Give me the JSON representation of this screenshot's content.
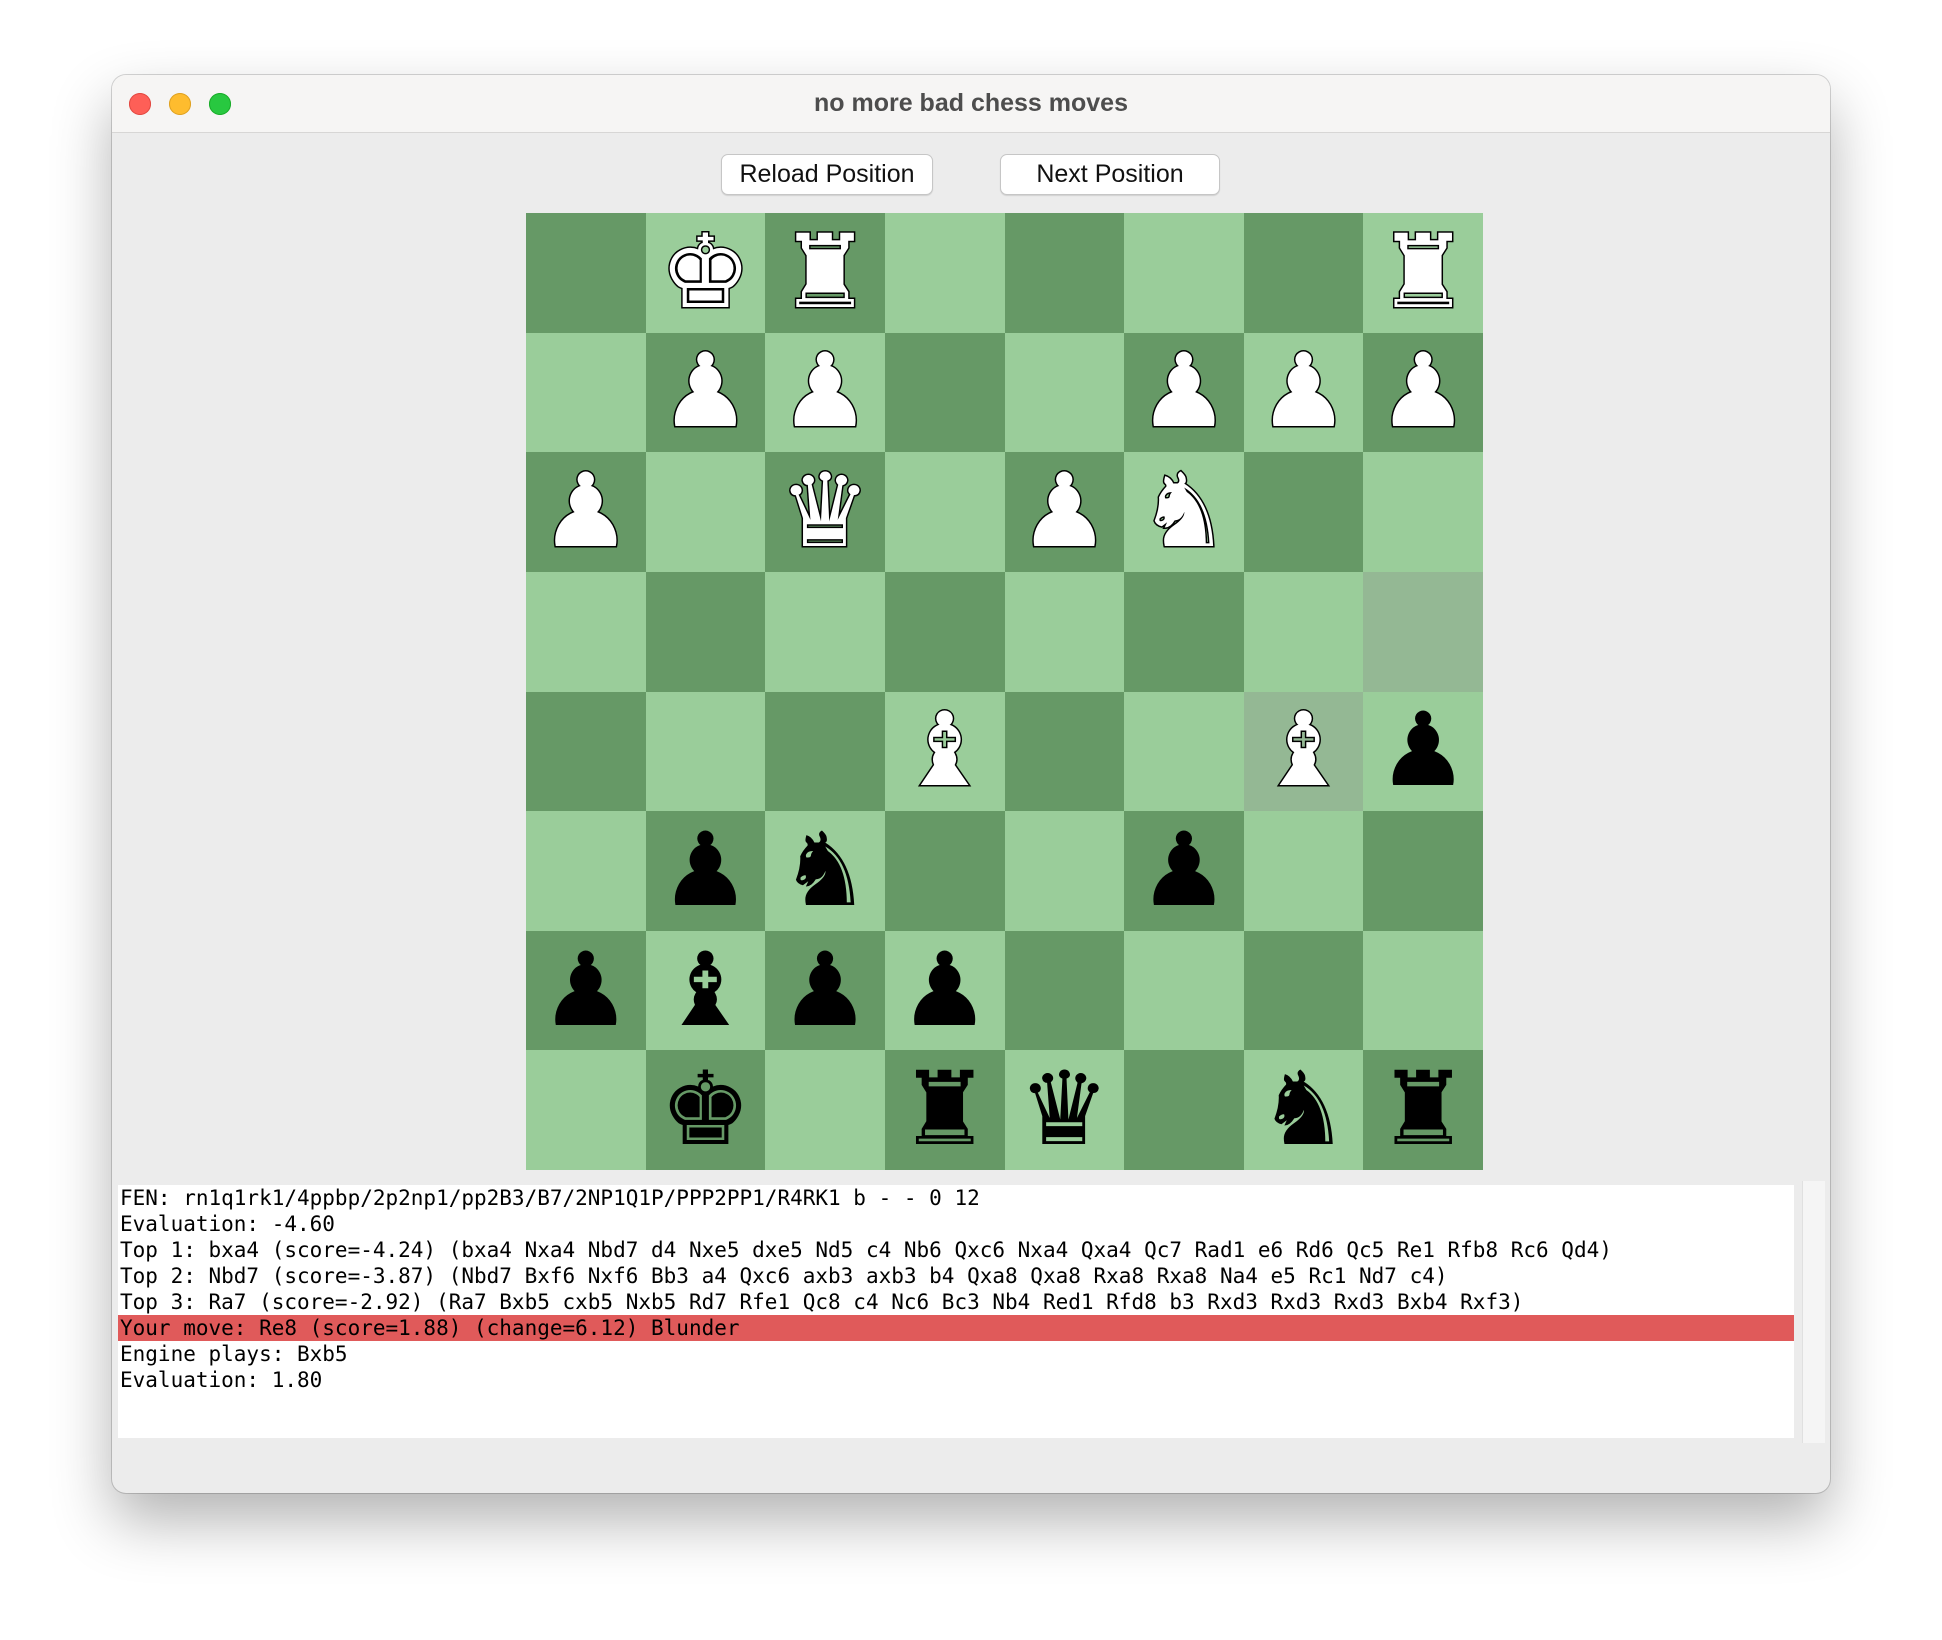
{
  "window": {
    "title": "no more bad chess moves"
  },
  "toolbar": {
    "reload_label": "Reload Position",
    "next_label": "Next Position"
  },
  "colors": {
    "light_square": "#9acd9a",
    "dark_square": "#669966",
    "highlight_square": "#94b894",
    "blunder_highlight": "#e05a5a"
  },
  "board": {
    "rows": [
      [
        ".",
        "K",
        "R",
        ".",
        ".",
        ".",
        ".",
        "R"
      ],
      [
        ".",
        "P",
        "P",
        ".",
        ".",
        "P",
        "P",
        "P"
      ],
      [
        "P",
        ".",
        "Q",
        ".",
        "P",
        "N",
        ".",
        "."
      ],
      [
        ".",
        ".",
        ".",
        ".",
        ".",
        ".",
        ".",
        "."
      ],
      [
        ".",
        ".",
        ".",
        "B",
        ".",
        ".",
        "B",
        "p"
      ],
      [
        ".",
        "p",
        "n",
        ".",
        ".",
        "p",
        ".",
        "."
      ],
      [
        "p",
        "b",
        "p",
        "p",
        ".",
        ".",
        ".",
        "."
      ],
      [
        ".",
        "k",
        ".",
        "r",
        "q",
        ".",
        "n",
        "r"
      ]
    ],
    "highlighted": [
      "3-7",
      "4-6"
    ]
  },
  "analysis": {
    "lines": [
      "FEN: rn1q1rk1/4ppbp/2p2np1/pp2B3/B7/2NP1Q1P/PPP2PP1/R4RK1 b - - 0 12",
      "Evaluation: -4.60",
      "Top 1: bxa4 (score=-4.24) (bxa4 Nxa4 Nbd7 d4 Nxe5 dxe5 Nd5 c4 Nb6 Qxc6 Nxa4 Qxa4 Qc7 Rad1 e6 Rd6 Qc5 Re1 Rfb8 Rc6 Qd4)",
      "Top 2: Nbd7 (score=-3.87) (Nbd7 Bxf6 Nxf6 Bb3 a4 Qxc6 axb3 axb3 b4 Qxa8 Qxa8 Rxa8 Rxa8 Na4 e5 Rc1 Nd7 c4)",
      "Top 3: Ra7 (score=-2.92) (Ra7 Bxb5 cxb5 Nxb5 Rd7 Rfe1 Qc8 c4 Nc6 Bc3 Nb4 Red1 Rfd8 b3 Rxd3 Rxd3 Rxd3 Bxb4 Rxf3)",
      "Your move: Re8 (score=1.88) (change=6.12) Blunder",
      "Engine plays: Bxb5",
      "Evaluation: 1.80"
    ]
  }
}
